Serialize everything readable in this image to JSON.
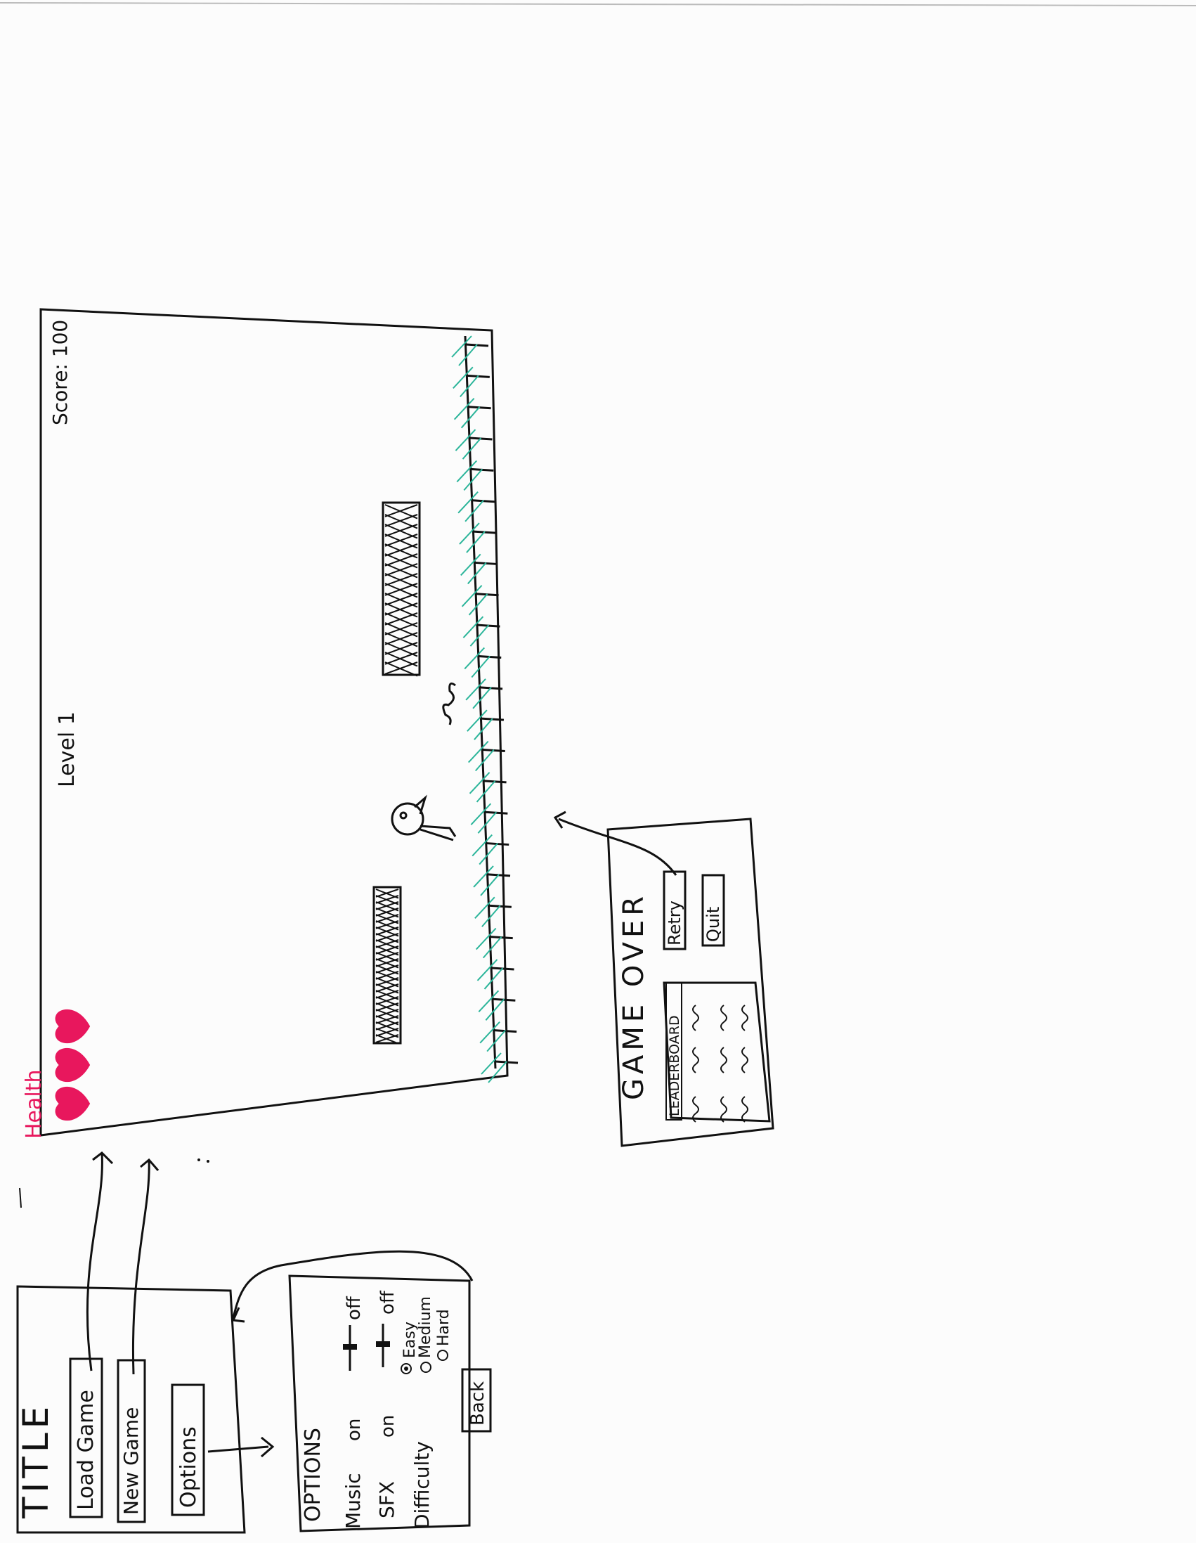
{
  "game_screen": {
    "level_label": "Level 1",
    "score_label": "Score: 100",
    "health_label": "Health",
    "hearts_count": 3
  },
  "title_screen": {
    "title": "TITLE",
    "load_game_label": "Load Game",
    "new_game_label": "New Game",
    "options_label": "Options"
  },
  "options_screen": {
    "heading": "OPTIONS",
    "music_label": "Music",
    "music_on": "on",
    "music_off": "off",
    "sfx_label": "SFX",
    "sfx_on": "on",
    "sfx_off": "off",
    "difficulty_label": "Difficulty",
    "difficulty_options": [
      "Easy",
      "Medium",
      "Hard"
    ],
    "difficulty_selected": "Easy",
    "back_label": "Back"
  },
  "game_over_screen": {
    "heading": "GAME OVER",
    "leaderboard_label": "LEADERBOARD",
    "retry_label": "Retry",
    "quit_label": "Quit"
  },
  "colors": {
    "ink": "#111111",
    "grass": "#2bb59a",
    "heart": "#e8175d"
  }
}
